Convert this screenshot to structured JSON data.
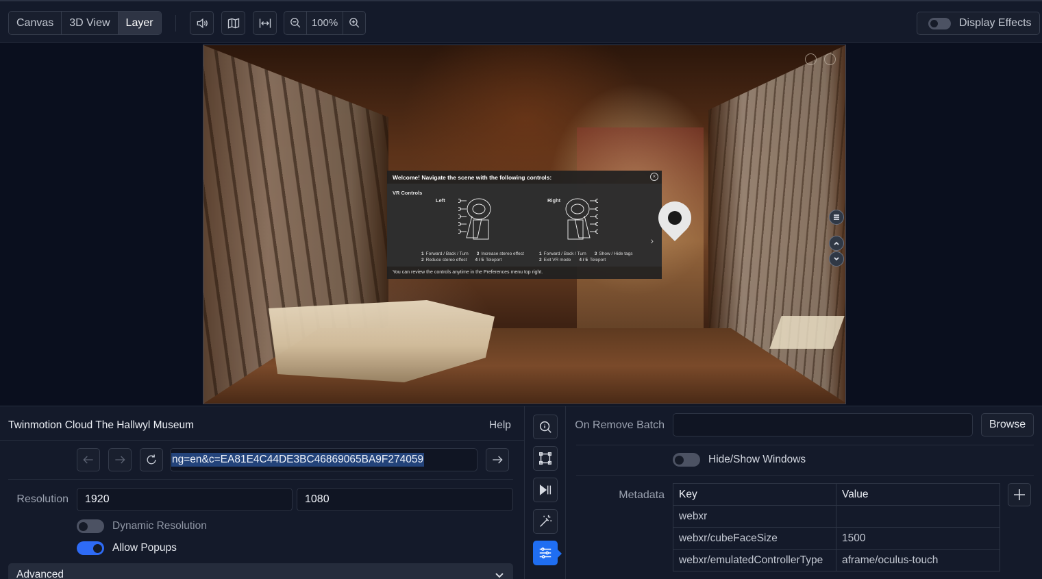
{
  "toolbar": {
    "view_tabs": [
      "Canvas",
      "3D View",
      "Layer"
    ],
    "active_tab": "Layer",
    "zoom_level": "100%",
    "display_effects_label": "Display Effects",
    "display_effects_on": false,
    "icons": [
      "speaker-icon",
      "map-icon",
      "fit-width-icon",
      "zoom-out-icon",
      "zoom-in-icon"
    ]
  },
  "scene": {
    "modal_title": "Welcome! Navigate the scene with the following controls:",
    "modal_close": "×",
    "vr_controls_label": "VR Controls",
    "left_label": "Left",
    "right_label": "Right",
    "left_legend_line1_a": "Forward / Back / Turn",
    "left_legend_line1_b": "Increase stereo effect",
    "left_legend_line2_a": "Reduce stereo effect",
    "left_legend_line2_b": "Teleport",
    "right_legend_line1_a": "Forward / Back / Turn",
    "right_legend_line1_b": "Show / Hide tags",
    "right_legend_line2_a": "Exit VR mode",
    "right_legend_line2_b": "Teleport",
    "legend_n1": "1",
    "legend_n2": "2",
    "legend_n3": "3",
    "legend_n45": "4 / 5",
    "modal_footer": "You can review the controls anytime in the Preferences menu top right.",
    "next_glyph": "›"
  },
  "panel": {
    "title": "Twinmotion Cloud  The Hallwyl Museum",
    "help_label": "Help",
    "url_value": "ng=en&c=EA81E4C44DE3BC46869065BA9F274059",
    "resolution_label": "Resolution",
    "resolution_width": "1920",
    "resolution_height": "1080",
    "dynamic_resolution_label": "Dynamic Resolution",
    "dynamic_resolution_on": false,
    "allow_popups_label": "Allow Popups",
    "allow_popups_on": true,
    "advanced_label": "Advanced"
  },
  "properties": {
    "on_remove_batch_label": "On Remove Batch",
    "on_remove_batch_value": "",
    "browse_label": "Browse",
    "hide_show_windows_label": "Hide/Show Windows",
    "hide_show_windows_on": false,
    "metadata_label": "Metadata",
    "metadata_columns": [
      "Key",
      "Value"
    ],
    "metadata_rows": [
      {
        "key": "webxr",
        "value": ""
      },
      {
        "key": "webxr/cubeFaceSize",
        "value": "1500"
      },
      {
        "key": "webxr/emulatedControllerType",
        "value": "aframe/oculus-touch"
      }
    ]
  },
  "colors": {
    "accent": "#1f6ef2",
    "background": "#141a2a",
    "canvas_background": "#0a0f1e"
  }
}
